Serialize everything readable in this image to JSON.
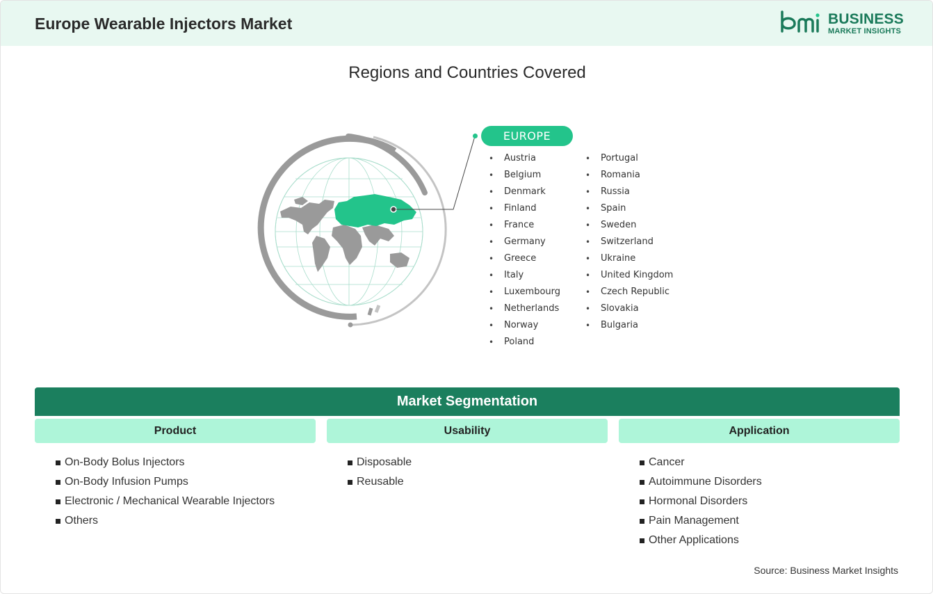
{
  "header": {
    "title": "Europe Wearable Injectors Market",
    "logo": {
      "word1": "BUSINESS",
      "word2": "MARKET INSIGHTS",
      "color": "#1a7a5a"
    }
  },
  "regions": {
    "title": "Regions and Countries Covered",
    "region_label": "EUROPE",
    "countries_col1": [
      "Austria",
      "Belgium",
      "Denmark",
      "Finland",
      "France",
      "Germany",
      "Greece",
      "Italy",
      "Luxembourg",
      "Netherlands",
      "Norway",
      "Poland"
    ],
    "countries_col2": [
      "Portugal",
      "Romania",
      "Russia",
      "Spain",
      "Sweden",
      "Switzerland",
      "Ukraine",
      "United Kingdom",
      "Czech Republic",
      "Slovakia",
      "Bulgaria"
    ]
  },
  "segmentation": {
    "title": "Market Segmentation",
    "columns": [
      {
        "heading": "Product",
        "items": [
          "On-Body Bolus Injectors",
          "On-Body Infusion Pumps",
          "Electronic / Mechanical Wearable Injectors",
          "Others"
        ]
      },
      {
        "heading": "Usability",
        "items": [
          "Disposable",
          "Reusable"
        ]
      },
      {
        "heading": "Application",
        "items": [
          "Cancer",
          "Autoimmune Disorders",
          "Hormonal Disorders",
          "Pain Management",
          "Other Applications"
        ]
      }
    ]
  },
  "source": "Source: Business Market Insights",
  "colors": {
    "accent": "#23c48b",
    "band": "#1b7f5e",
    "light_band": "#aef5d9",
    "header_bg": "#e8f8f1",
    "map_gray": "#9a9a9a"
  }
}
